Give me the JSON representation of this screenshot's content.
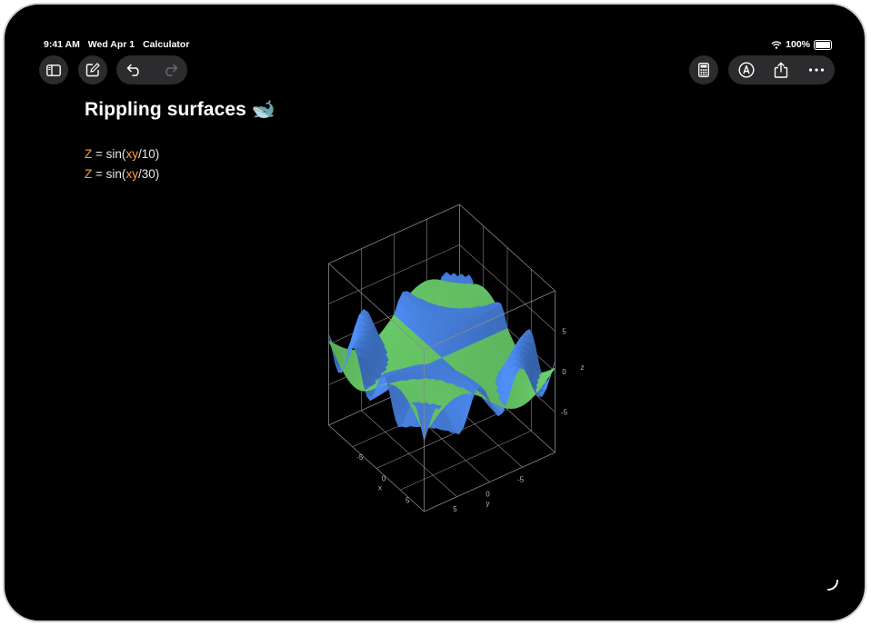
{
  "status_bar": {
    "time": "9:41 AM",
    "date": "Wed Apr 1",
    "app": "Calculator",
    "battery": "100%"
  },
  "toolbar": {
    "left": [
      "sidebar-icon",
      "compose-icon",
      "undo-icon",
      "redo-icon"
    ],
    "right": [
      "calculator-icon",
      "markup-icon",
      "share-icon",
      "more-icon"
    ]
  },
  "note": {
    "title": "Rippling surfaces 🐋",
    "equations": [
      {
        "lhs": "Z",
        "eq": "=",
        "fn_open": "sin(",
        "arg": "xy",
        "rest": "/10)"
      },
      {
        "lhs": "Z",
        "eq": "=",
        "fn_open": "sin(",
        "arg": "xy",
        "rest": "/30)"
      }
    ]
  },
  "chart_data": {
    "type": "surface-3d",
    "x_label": "x",
    "y_label": "y",
    "z_label": "z",
    "x_ticks": [
      "-5",
      "0",
      "5"
    ],
    "y_ticks": [
      "5",
      "0",
      "-5"
    ],
    "z_ticks": [
      "5",
      "0",
      "-5"
    ],
    "series": [
      {
        "name": "",
        "expression": "Z = sin(xy/10)",
        "color": "#4a86e8"
      },
      {
        "name": "",
        "expression": "Z = sin(xy/30)",
        "color": "#6bd06b"
      }
    ]
  },
  "colors": {
    "background": "#000000",
    "variable": "#ff9f43",
    "surface_blue": "#4a86e8",
    "surface_green": "#6bd06b"
  }
}
